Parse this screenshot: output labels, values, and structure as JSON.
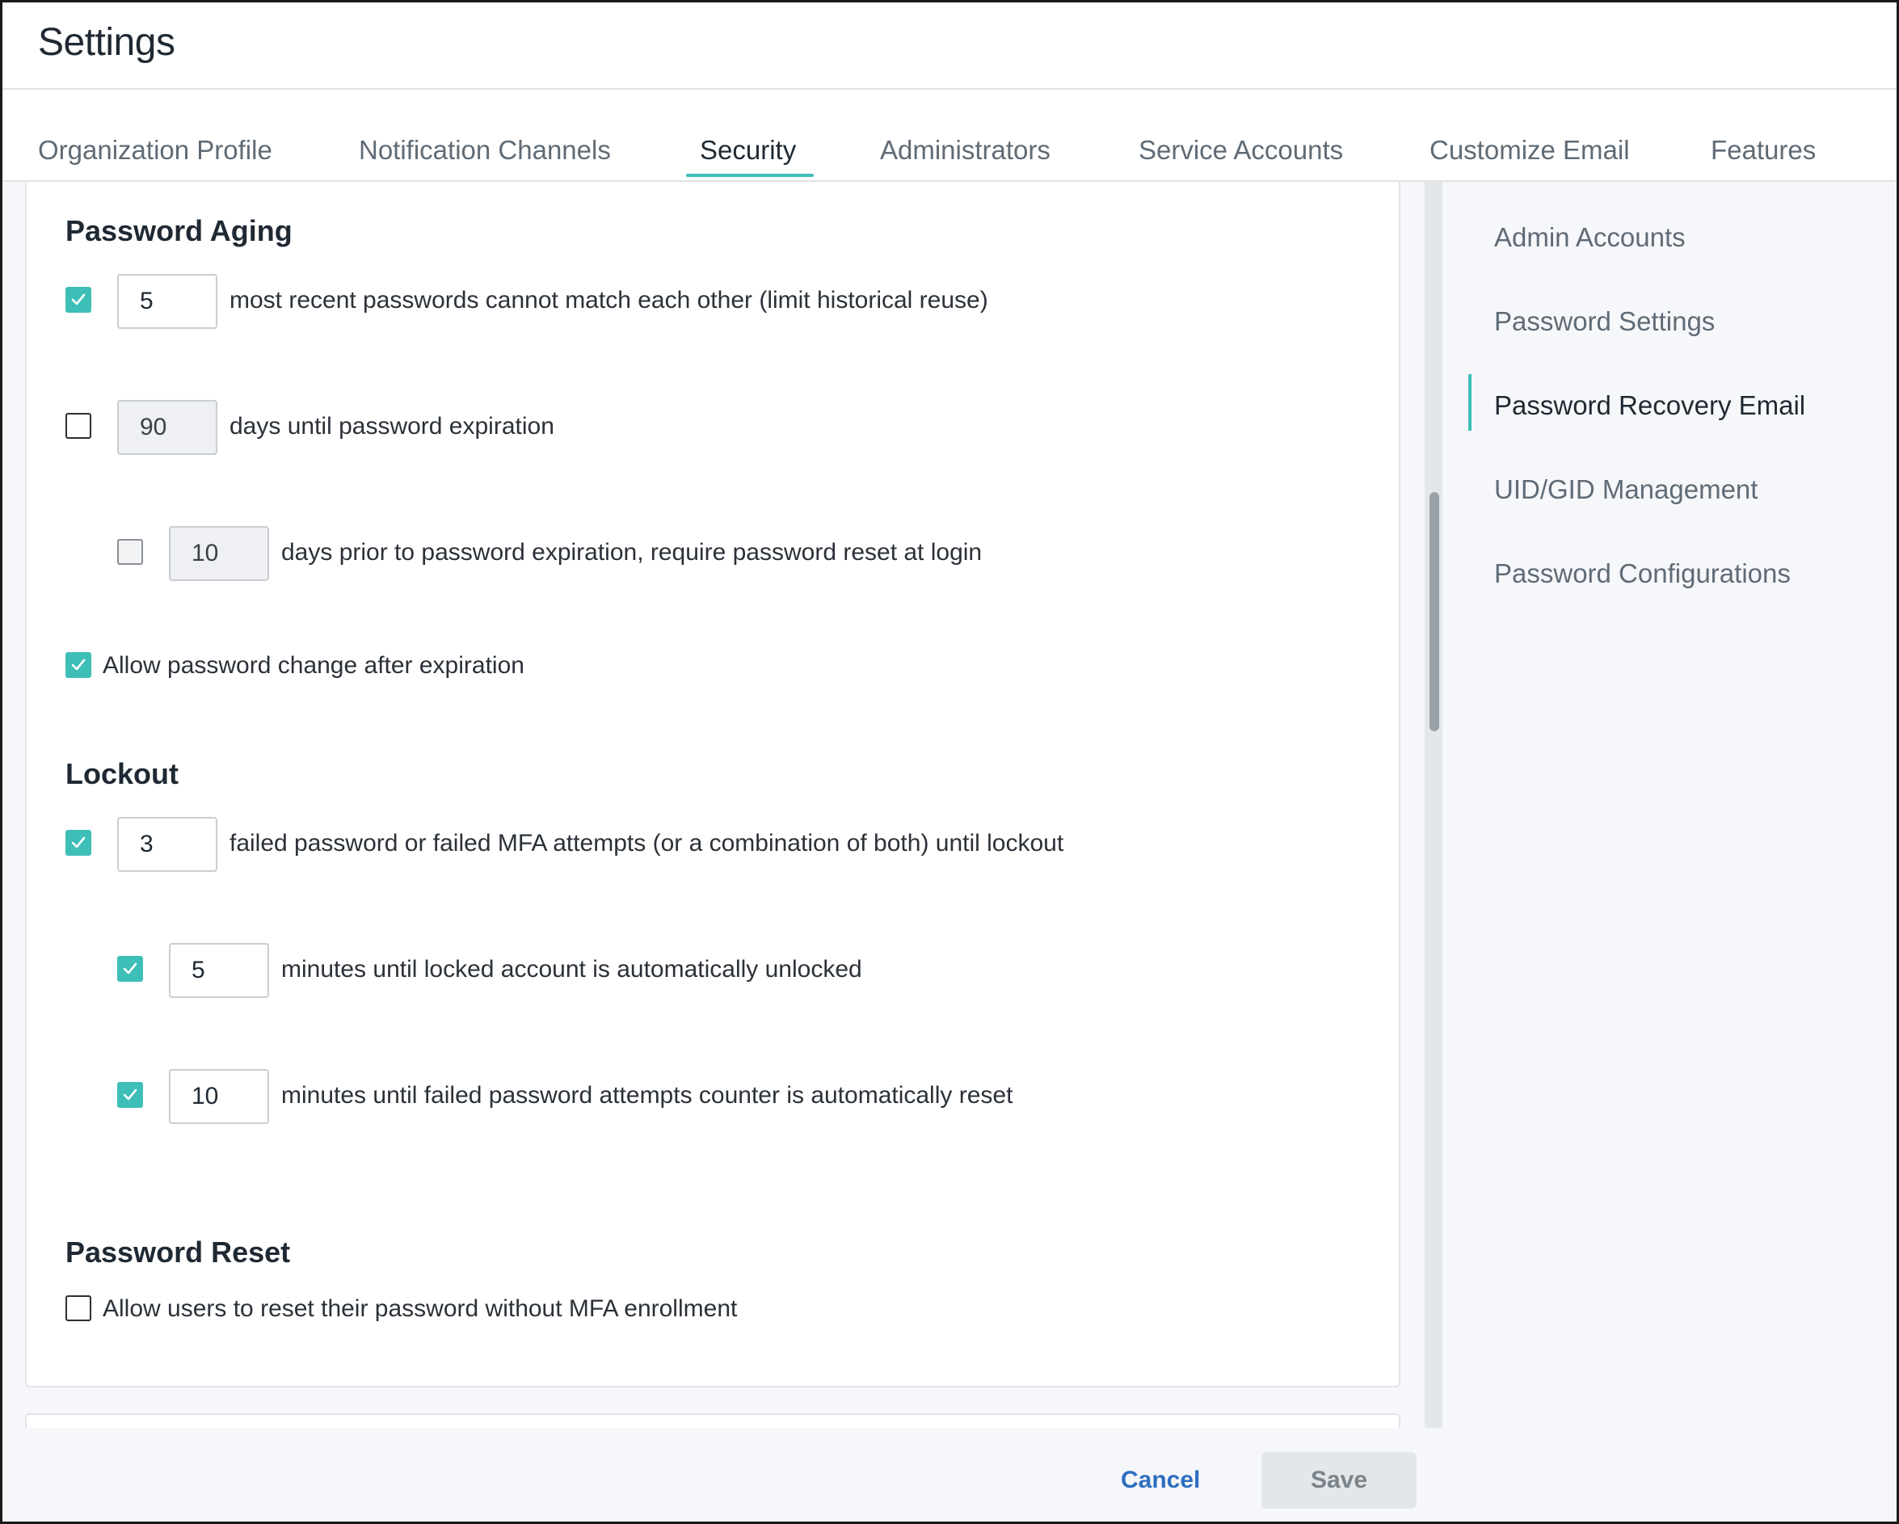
{
  "header": {
    "title": "Settings"
  },
  "tabs": [
    {
      "label": "Organization Profile"
    },
    {
      "label": "Notification Channels"
    },
    {
      "label": "Security",
      "active": true
    },
    {
      "label": "Administrators"
    },
    {
      "label": "Service Accounts"
    },
    {
      "label": "Customize Email"
    },
    {
      "label": "Features"
    }
  ],
  "password_aging": {
    "title": "Password Aging",
    "history": {
      "checked": true,
      "value": "5",
      "label": "most recent passwords cannot match each other (limit historical reuse)"
    },
    "expiration": {
      "checked": false,
      "value": "90",
      "label": "days until password expiration"
    },
    "reset_prior": {
      "checked": false,
      "value": "10",
      "label": "days prior to password expiration, require password reset at login"
    },
    "allow_change": {
      "checked": true,
      "label": "Allow password change after expiration"
    }
  },
  "lockout": {
    "title": "Lockout",
    "attempts": {
      "checked": true,
      "value": "3",
      "label": "failed password or failed MFA attempts (or a combination of both) until lockout"
    },
    "unlock": {
      "checked": true,
      "value": "5",
      "label": "minutes until locked account is automatically unlocked"
    },
    "counter_reset": {
      "checked": true,
      "value": "10",
      "label": "minutes until failed password attempts counter is automatically reset"
    }
  },
  "password_reset": {
    "title": "Password Reset",
    "allow_without_mfa": {
      "checked": false,
      "label": "Allow users to reset their password without MFA enrollment"
    }
  },
  "right_nav": [
    {
      "label": "Admin Accounts"
    },
    {
      "label": "Password Settings"
    },
    {
      "label": "Password Recovery Email",
      "active": true
    },
    {
      "label": "UID/GID Management"
    },
    {
      "label": "Password Configurations"
    }
  ],
  "footer": {
    "cancel_label": "Cancel",
    "save_label": "Save"
  },
  "colors": {
    "accent": "#3dbfb8",
    "link": "#2e6fbf"
  }
}
